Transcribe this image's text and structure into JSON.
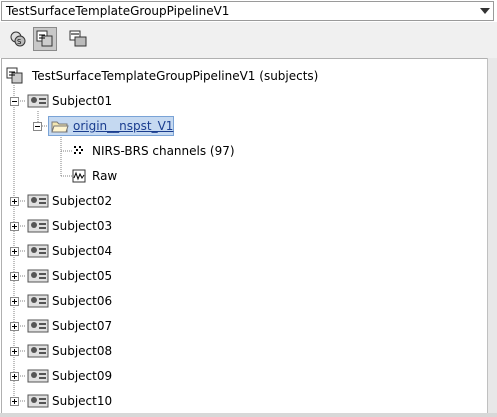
{
  "dropdown": {
    "selected": "TestSurfaceTemplateGroupPipelineV1"
  },
  "toolbar": {
    "buttons": [
      "protocol-icon",
      "subjects-icon",
      "conditions-icon"
    ]
  },
  "tree": {
    "root": {
      "label": "TestSurfaceTemplateGroupPipelineV1 (subjects)"
    },
    "subject01": {
      "label": "Subject01",
      "study": {
        "label": "origin__nspst_V1"
      },
      "channels": {
        "label": "NIRS-BRS channels (97)"
      },
      "raw": {
        "label": "Raw"
      }
    },
    "subjects": [
      "Subject02",
      "Subject03",
      "Subject04",
      "Subject05",
      "Subject06",
      "Subject07",
      "Subject08",
      "Subject09",
      "Subject10"
    ]
  }
}
